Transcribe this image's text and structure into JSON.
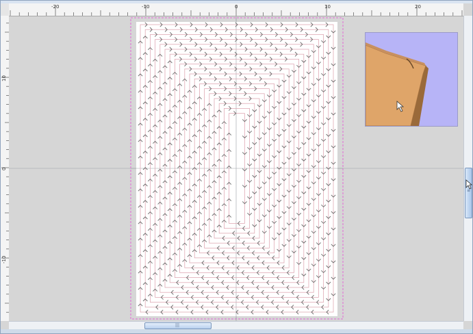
{
  "rulers": {
    "horizontal_labels": [
      "-20",
      "-10",
      "0",
      "10",
      "20"
    ],
    "vertical_labels": [
      "10",
      "0",
      "-10"
    ]
  },
  "canvas": {
    "background_color": "#d6d6d6",
    "material_color": "#ffffff",
    "boundary_color": "#e36ad6",
    "toolpath_color": "#e0aab5",
    "arrow_color": "#6a6a6a",
    "axis_color": "#9aa0a6"
  },
  "preview": {
    "background_color": "#b7b4f7",
    "block_color": "#e2a86a",
    "icon": "mouse-cursor-icon"
  },
  "scrollbars": {
    "vertical_icon": "grip-icon",
    "horizontal_icon": "grip-icon"
  }
}
